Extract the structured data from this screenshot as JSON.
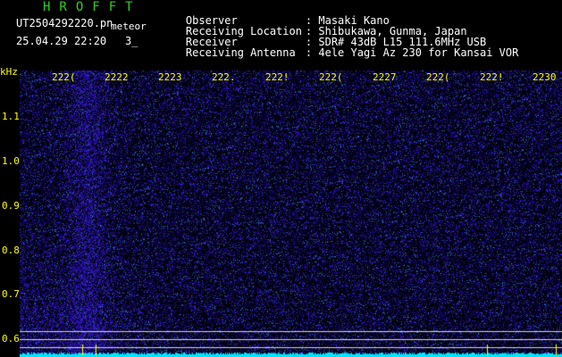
{
  "header": {
    "title": "HROFFT",
    "filename": "UT2504292220.pn",
    "meteor_label": "meteor",
    "datetime": "25.04.29 22:20",
    "counter": "3_"
  },
  "station": {
    "rows": [
      {
        "key": "Observer",
        "sep": ":",
        "value": "Masaki Kano"
      },
      {
        "key": "Receiving Location",
        "sep": ":",
        "value": "Shibukawa, Gunma, Japan"
      },
      {
        "key": "Receiver",
        "sep": ":",
        "value": "SDR# 43dB L15 111.6MHz USB"
      },
      {
        "key": "Receiving Antenna",
        "sep": ":",
        "value": "4ele Yagi Az 230 for Kansai VOR"
      }
    ]
  },
  "axes": {
    "y_unit": "kHz",
    "y_ticks": [
      "1.1",
      "1.0",
      "0.9",
      "0.8",
      "0.7",
      "0.6"
    ],
    "x_ticks": [
      "222(",
      "2222",
      "2223",
      "222.",
      "222!",
      "222(",
      "2227",
      "222(",
      "222!",
      "2230"
    ]
  },
  "colors": {
    "background": "#000000",
    "waterfall_noise": "#1a1aff",
    "amplitude_trace": "#00e5ff",
    "axis_text": "#ffff00",
    "title_text": "#2fd11b"
  }
}
